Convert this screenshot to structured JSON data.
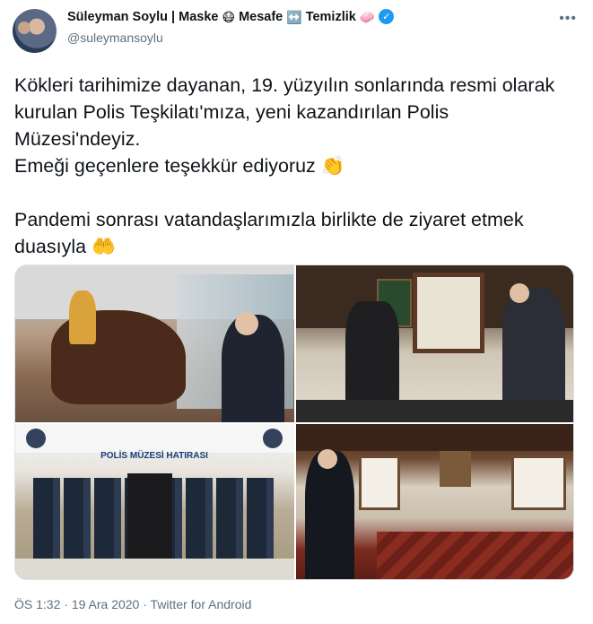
{
  "author": {
    "name": "Süleyman Soylu | Maske",
    "name_emoji_1": "😷",
    "name_part2": "Mesafe",
    "name_emoji_2": "↔️",
    "name_part3": "Temizlik",
    "name_emoji_3": "🧼",
    "handle": "@suleymansoylu",
    "verified": true
  },
  "tweet": {
    "text": "Kökleri tarihimize dayanan, 19. yüzyılın sonlarında resmi olarak kurulan Polis Teşkilatı'mıza, yeni kazandırılan Polis Müzesi'ndeyiz.\nEmeği geçenlere teşekkür ediyoruz 👏\n\nPandemi sonrası vatandaşlarımızla birlikte de ziyaret etmek duasıyla 🤲"
  },
  "photos": [
    {
      "sign": ""
    },
    {
      "sign": ""
    },
    {
      "sign": "POLİS MÜZESİ HATIRASI"
    },
    {
      "sign": ""
    }
  ],
  "meta": {
    "time": "ÖS 1:32",
    "date": "19 Ara 2020",
    "source": "Twitter for Android",
    "separator": "·"
  },
  "colors": {
    "verified": "#1d9bf0",
    "muted": "#5b7083"
  }
}
